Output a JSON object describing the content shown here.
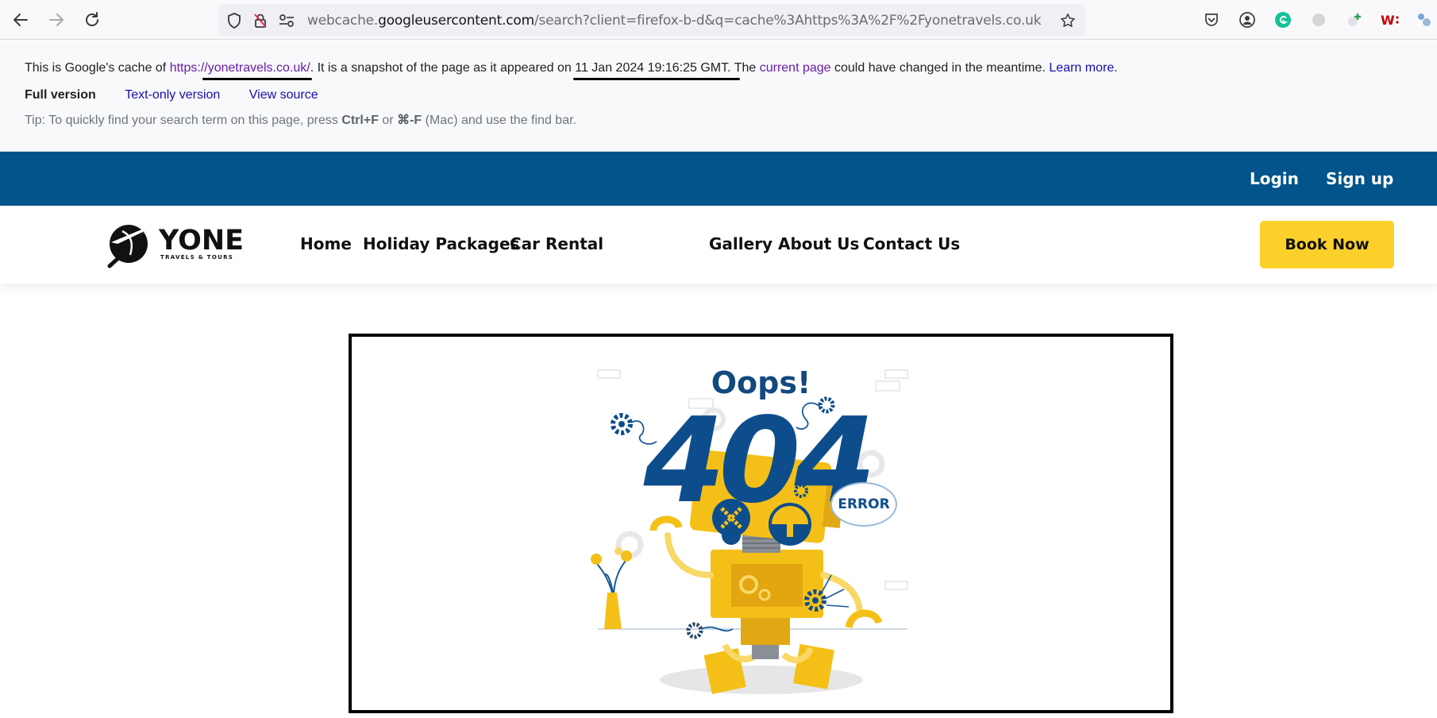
{
  "browser": {
    "url_prefix": "webcache.",
    "url_host": "googleusercontent.com",
    "url_rest": "/search?client=firefox-b-d&q=cache%3Ahttps%3A%2F%2Fyonetravels.co.uk",
    "icons": [
      "back-icon",
      "forward-icon",
      "reload-icon",
      "shield-icon",
      "tracking-lock-icon",
      "permissions-icon",
      "bookmark-star-icon",
      "pocket-icon",
      "account-icon",
      "grammarly-icon",
      "extension-gray-icon",
      "extension-plus-icon",
      "extension-w-icon",
      "extensions-puzzle-icon"
    ]
  },
  "cache": {
    "intro": "This is Google's cache of ",
    "cached_url": "https://yonetravels.co.uk/",
    "snapshot_text": ". It is a snapshot of the page as it appeared on ",
    "snapshot_date": "11 Jan 2024 19:16:25 GMT",
    "after_date": ". The ",
    "current_page": "current page",
    "changed_text": " could have changed in the meantime. ",
    "learn_more": "Learn more",
    "period": ".",
    "full_version": "Full version",
    "text_only": "Text-only version",
    "view_source": "View source",
    "tip_prefix": "Tip: To quickly find your search term on this page, press ",
    "tip_key1": "Ctrl+F",
    "tip_or": " or ",
    "tip_key2": "⌘-F",
    "tip_suffix": " (Mac) and use the find bar."
  },
  "site": {
    "topbar_color": "#02548a",
    "login": "Login",
    "signup": "Sign up",
    "logo_word": "YONE",
    "logo_tagline": "TRAVELS & TOURS",
    "nav": [
      "Home",
      "Holiday Packages",
      "Car Rental",
      "Gallery",
      "About Us",
      "Contact Us"
    ],
    "book_now": "Book Now",
    "accent": "#fcd02b"
  },
  "error_image": {
    "oops": "Oops!",
    "code": "404",
    "bubble": "ERROR"
  }
}
